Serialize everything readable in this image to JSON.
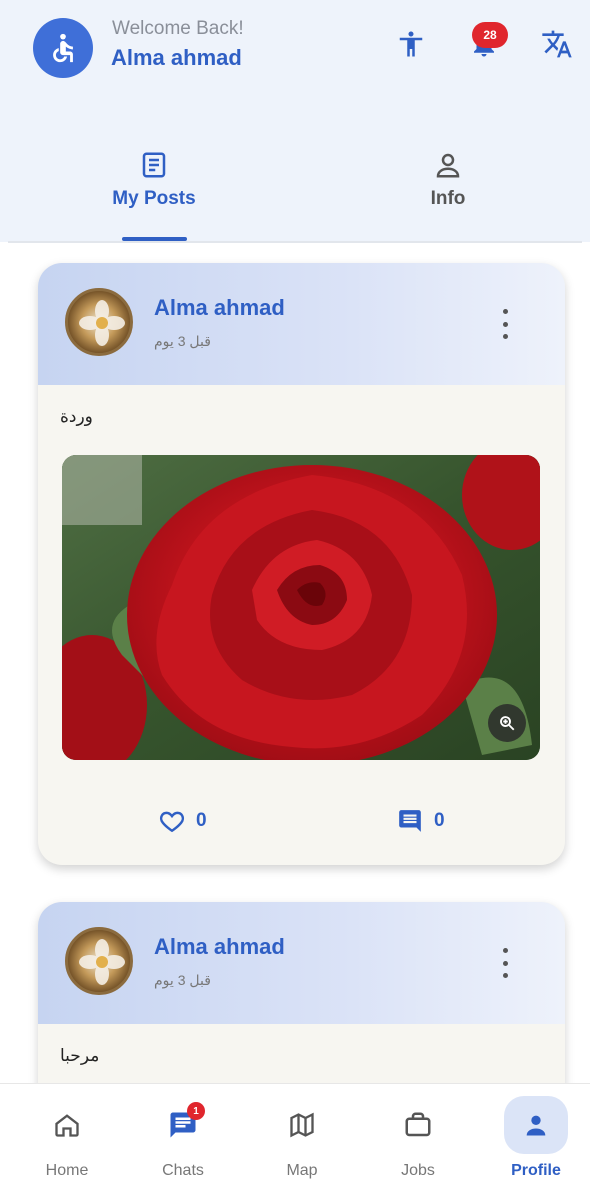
{
  "header": {
    "welcome": "Welcome Back!",
    "username": "Alma ahmad",
    "notification_count": "28",
    "icons": [
      "accessibility-wheelchair-icon",
      "accessibility-person-icon",
      "bell-icon",
      "translate-icon"
    ]
  },
  "tabs": [
    {
      "label": "My Posts",
      "icon": "document-icon",
      "active": true
    },
    {
      "label": "Info",
      "icon": "person-icon",
      "active": false
    }
  ],
  "posts": [
    {
      "author": "Alma ahmad",
      "time": "قبل 3 يوم",
      "text": "وردة",
      "image": "red-rose-photo",
      "likes": "0",
      "comments": "0"
    },
    {
      "author": "Alma ahmad",
      "time": "قبل 3 يوم",
      "text": "مرحبا"
    }
  ],
  "bottom_nav": [
    {
      "label": "Home",
      "icon": "home-icon"
    },
    {
      "label": "Chats",
      "icon": "chat-icon",
      "badge": "1"
    },
    {
      "label": "Map",
      "icon": "map-icon"
    },
    {
      "label": "Jobs",
      "icon": "briefcase-icon"
    },
    {
      "label": "Profile",
      "icon": "person-icon",
      "active": true
    }
  ],
  "colors": {
    "accent": "#2f5fc4",
    "header_bg": "#eef3fb",
    "badge": "#e0262d",
    "card_bg": "#f7f6f1"
  }
}
